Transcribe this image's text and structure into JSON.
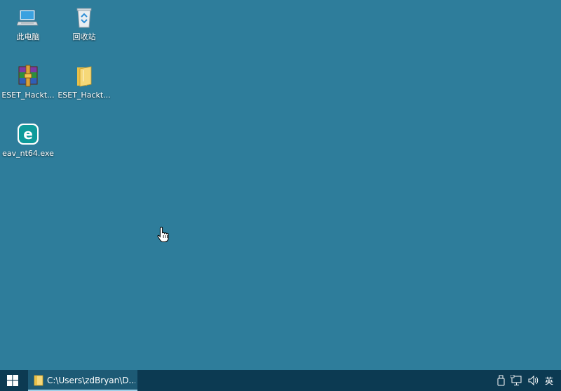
{
  "desktop": {
    "background_color": "#2e7d9b",
    "icons": [
      {
        "label": "此电脑",
        "icon": "this-pc-icon"
      },
      {
        "label": "回收站",
        "icon": "recycle-bin-icon"
      },
      {
        "label": "ESET_Hackt...",
        "icon": "winrar-archive-icon"
      },
      {
        "label": "ESET_Hackt...",
        "icon": "folder-icon"
      },
      {
        "label": "eav_nt64.exe",
        "icon": "eset-installer-icon"
      }
    ]
  },
  "cursor": {
    "icon": "hand-pointer-icon"
  },
  "taskbar": {
    "background_color": "#0c3a52",
    "start_icon": "windows-start-icon",
    "items": [
      {
        "label": "C:\\Users\\zdBryan\\D...",
        "icon": "folder-icon"
      }
    ],
    "tray": {
      "icons": [
        "usb-drive-icon",
        "network-icon",
        "volume-icon"
      ],
      "ime_label": "英"
    }
  }
}
